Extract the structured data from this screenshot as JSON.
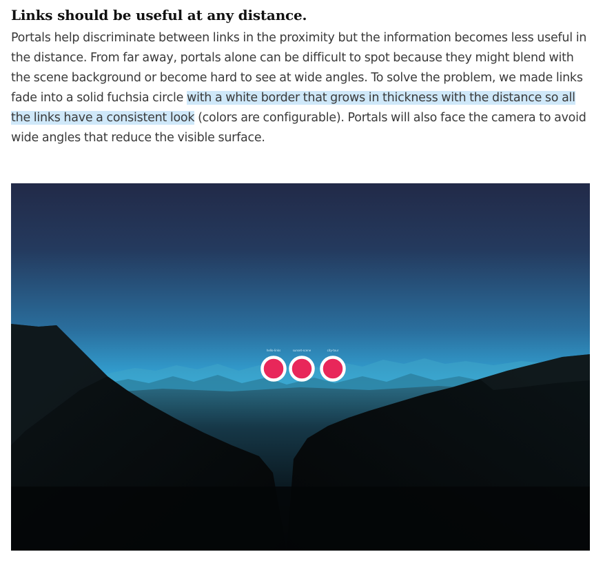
{
  "article": {
    "heading": "Links should be useful at any distance.",
    "paragraph_before": "Portals help discriminate between links in the proximity but the information becomes less useful in the distance. From far away, portals alone can be difficult to spot because they might blend with the scene background or become hard to see at wide angles. To solve the problem, we made links fade into a solid fuchsia circle ",
    "paragraph_highlight": "with a white border that grows in thickness with the distance so all the links have a consistent look",
    "paragraph_after": " (colors are configurable). Portals will also face the camera to avoid wide angles that reduce the visible surface."
  },
  "figure": {
    "portal_labels": [
      "hello-links",
      "sunset-scene",
      "city-tour"
    ],
    "colors": {
      "sky_top": "#222a48",
      "sky_horizon": "#3ac8f6",
      "portal_fill": "#e8275a",
      "portal_border": "#ffffff",
      "terrain": "#050708"
    }
  }
}
